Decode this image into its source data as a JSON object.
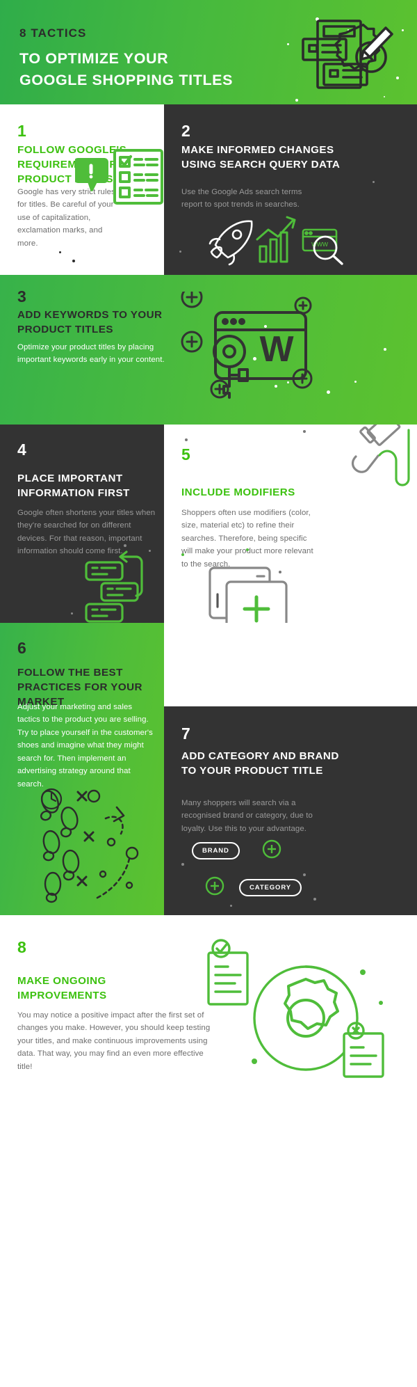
{
  "header": {
    "kicker": "8 TACTICS",
    "headline_line1": "TO OPTIMIZE YOUR",
    "headline_line2": "GOOGLE SHOPPING TITLES",
    "icon": "document-gear-pencil-icon"
  },
  "colors": {
    "green_bright": "#3cc10f",
    "green_panel": "#4fbd3a",
    "dark_panel": "#333333",
    "body_gray": "#6d6d6d",
    "body_light": "#9a9a9a",
    "white": "#ffffff",
    "near_black": "#2b2b2b"
  },
  "sections": [
    {
      "number": "1",
      "theme": "white",
      "heading": "FOLLOW GOOGLE'S REQUIREMENTS FOR PRODUCT TITLES",
      "body": "Google has very strict rules for titles. Be careful of your use of capitalization, exclamation marks, and more.",
      "icon": "checklist-and-alert-bubble-icon"
    },
    {
      "number": "2",
      "theme": "dark",
      "heading": "MAKE INFORMED CHANGES USING SEARCH QUERY DATA",
      "body": "Use the Google Ads search terms report to spot trends in searches.",
      "icon": "rocket-growth-chart-www-search-icon"
    },
    {
      "number": "3",
      "theme": "green",
      "heading": "ADD KEYWORDS TO YOUR PRODUCT TITLES",
      "body": "Optimize your product titles by placing important keywords early in your content.",
      "icon": "browser-keyword-key-icon"
    },
    {
      "number": "4",
      "theme": "dark",
      "heading": "PLACE IMPORTANT INFORMATION FIRST",
      "body": "Google often shortens your titles when they're searched for on different devices. For that reason, important information should come first.",
      "icon": "reorder-list-cards-icon"
    },
    {
      "number": "5",
      "theme": "white",
      "heading": "INCLUDE MODIFIERS",
      "body": "Shoppers often use modifiers (color, size, material etc) to refine their searches. Therefore, being specific will make your product more relevant to the search.",
      "icon": "paint-roller-icon",
      "icon_secondary": "stacked-cards-plus-icon"
    },
    {
      "number": "6",
      "theme": "green",
      "heading": "FOLLOW THE BEST PRACTICES FOR YOUR MARKET",
      "body": "Adjust your marketing and sales tactics to the product you are selling. Try to place yourself in the customer's shoes and imagine what they might search for. Then implement an advertising strategy around that search.",
      "icon": "footprints-path-icon"
    },
    {
      "number": "7",
      "theme": "dark",
      "heading": "ADD CATEGORY AND BRAND TO YOUR PRODUCT TITLE",
      "body": "Many shoppers will search via a recognised brand or category, due to loyalty. Use this to your advantage.",
      "icon": "brand-category-tags-icon",
      "tags": [
        "BRAND",
        "CATEGORY"
      ]
    },
    {
      "number": "8",
      "theme": "white",
      "heading": "MAKE ONGOING IMPROVEMENTS",
      "body": "You may notice a positive impact after the first set of changes you make. However, you should keep testing your titles, and make continuous improvements using data. That way, you may find an even more effective title!",
      "icon": "gear-settings-documents-icon"
    }
  ]
}
